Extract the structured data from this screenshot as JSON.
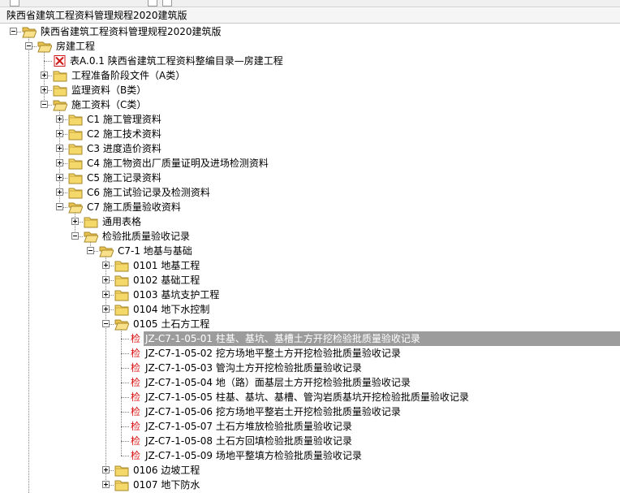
{
  "window": {
    "title": "陕西省建筑工程资料管理规程2020建筑版"
  },
  "icons": {
    "folder_open": "open-folder-icon",
    "folder_closed": "closed-folder-icon",
    "red_x": "red-x-document-icon",
    "check": "检"
  },
  "colors": {
    "selection_bg": "#9c9c9c",
    "check_glyph": "#d81010",
    "folder_yellow": "#f5d86a"
  },
  "tree": {
    "root": "陕西省建筑工程资料管理规程2020建筑版",
    "house": "房建工程",
    "doc_a01": "表A.0.1 陕西省建筑工程资料整编目录—房建工程",
    "cat_a": "工程准备阶段文件（A类）",
    "cat_b": "监理资料（B类）",
    "cat_c": "施工资料（C类）",
    "c1": "C1 施工管理资料",
    "c2": "C2 施工技术资料",
    "c3": "C3 进度造价资料",
    "c4": "C4 施工物资出厂质量证明及进场检测资料",
    "c5": "C5 施工记录资料",
    "c6": "C6 施工试验记录及检测资料",
    "c7": "C7 施工质量验收资料",
    "common": "通用表格",
    "batch": "检验批质量验收记录",
    "c7_1": "C7-1 地基与基础",
    "f0101": "0101 地基工程",
    "f0102": "0102 基础工程",
    "f0103": "0103 基坑支护工程",
    "f0104": "0104 地下水控制",
    "f0105": "0105 土石方工程",
    "r01": "JZ-C7-1-05-01 柱基、基坑、基槽土方开挖检验批质量验收记录",
    "r02": "JZ-C7-1-05-02 挖方场地平整土方开挖检验批质量验收记录",
    "r03": "JZ-C7-1-05-03 管沟土方开挖检验批质量验收记录",
    "r04": "JZ-C7-1-05-04 地（路）面基层土方开挖检验批质量验收记录",
    "r05": "JZ-C7-1-05-05 柱基、基坑、基槽、管沟岩质基坑开挖检验批质量验收记录",
    "r06": "JZ-C7-1-05-06 挖方场地平整岩土开挖检验批质量验收记录",
    "r07": "JZ-C7-1-05-07 土石方堆放检验批质量验收记录",
    "r08": "JZ-C7-1-05-08 土石方回填检验批质量验收记录",
    "r09": "JZ-C7-1-05-09 场地平整填方检验批质量验收记录",
    "f0106": "0106 边坡工程",
    "f0107": "0107 地下防水"
  }
}
